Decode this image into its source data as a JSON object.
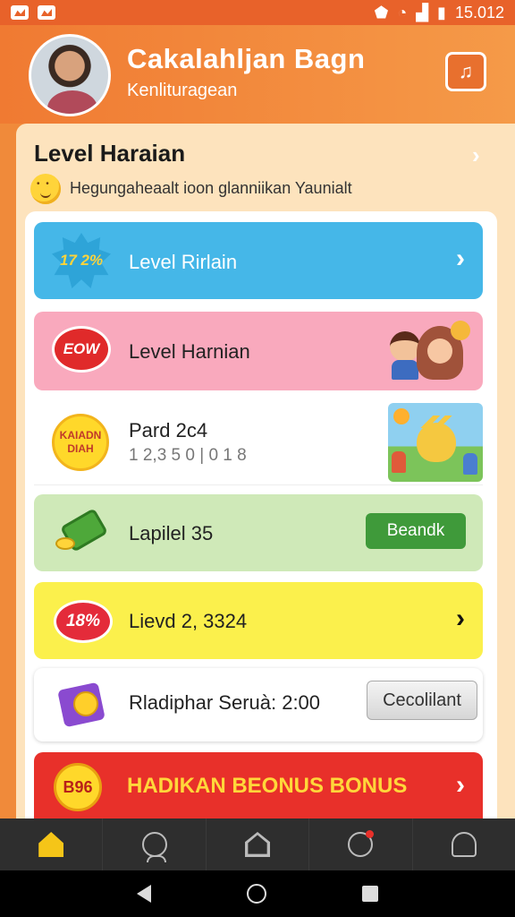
{
  "status_bar": {
    "time": "15.012"
  },
  "header": {
    "title": "Cakalahljan Bagn",
    "subtitle": "Kenlituragean",
    "icon": "music-note-icon"
  },
  "panel": {
    "title": "Level Haraian",
    "subtitle": "Hegungaheaalt ioon glanniikan Yaunialt"
  },
  "cards": [
    {
      "badge": "17 2%",
      "label": "Level Rirlain",
      "color": "#45b7e8"
    },
    {
      "badge": "EOW",
      "label": "Level Harnian",
      "color": "#f9a9bd"
    },
    {
      "badge_line1": "KAIADN",
      "badge_line2": "DIAH",
      "label": "Pard 2c4",
      "sub": "1 2,3 5 0 | 0 1 8",
      "color": "#ffffff"
    },
    {
      "label": "Lapilel 35",
      "button": "Beandk",
      "color": "#cfe9b8"
    },
    {
      "badge": "18%",
      "label": "Lievd 2, 3324",
      "color": "#fbf04c"
    },
    {
      "label": "Rladiphar Seruà: 2:00",
      "button": "Cecolilant",
      "color": "#ffffff"
    },
    {
      "badge": "B96",
      "label": "HADIKAN BEONUS BONUS",
      "color": "#e8302a"
    }
  ],
  "bottom_nav": [
    "home-icon",
    "profile-icon",
    "house-icon",
    "chat-icon",
    "rewards-icon"
  ]
}
